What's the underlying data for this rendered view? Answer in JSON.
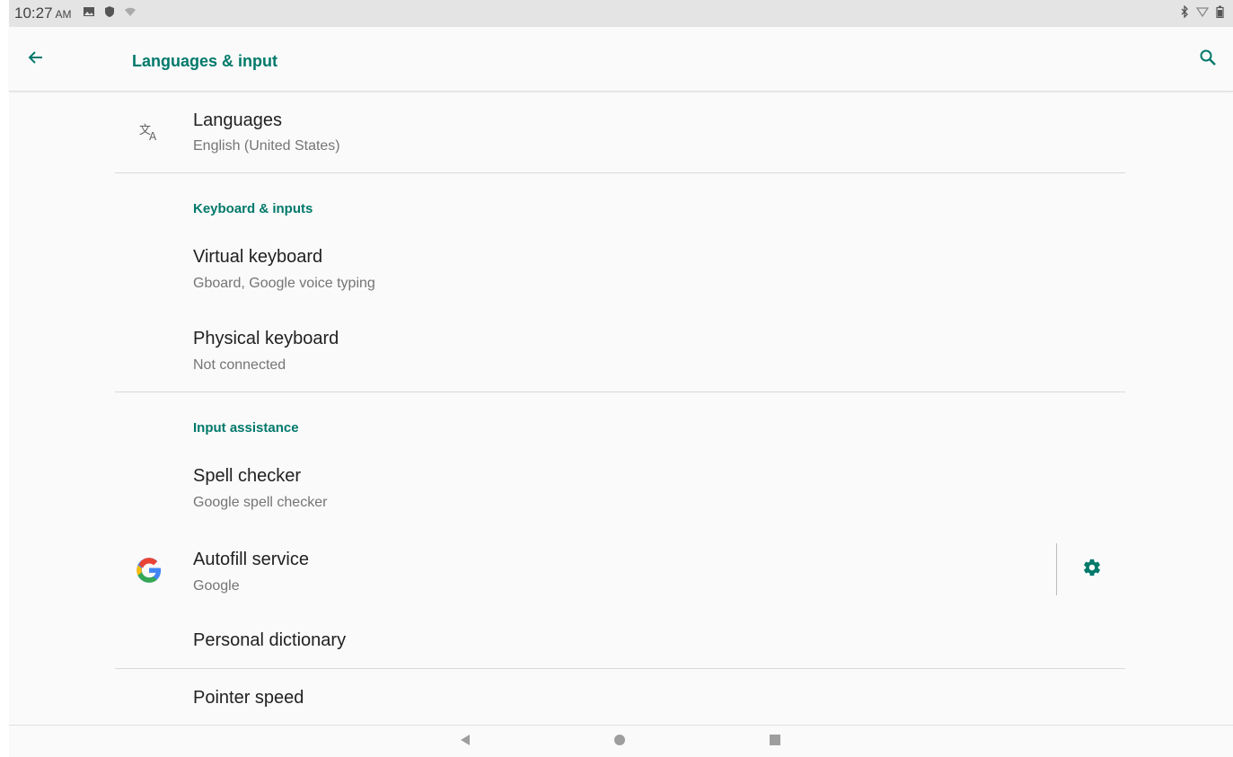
{
  "status_bar": {
    "time": "10:27",
    "ampm": "AM",
    "icons_left": [
      "image-icon",
      "shield-icon",
      "wifi-off-icon"
    ],
    "icons_right": [
      "bluetooth-icon",
      "signal-icon",
      "battery-icon"
    ]
  },
  "app_bar": {
    "title": "Languages & input",
    "back_icon": "arrow-left-icon",
    "search_icon": "search-icon"
  },
  "list": {
    "languages": {
      "title": "Languages",
      "summary": "English (United States)",
      "icon": "translate-icon"
    },
    "section_keyboard": "Keyboard & inputs",
    "virtual_keyboard": {
      "title": "Virtual keyboard",
      "summary": "Gboard, Google voice typing"
    },
    "physical_keyboard": {
      "title": "Physical keyboard",
      "summary": "Not connected"
    },
    "section_assistance": "Input assistance",
    "spell_checker": {
      "title": "Spell checker",
      "summary": "Google spell checker"
    },
    "autofill": {
      "title": "Autofill service",
      "summary": "Google",
      "icon": "google-icon",
      "settings_icon": "gear-icon"
    },
    "personal_dictionary": {
      "title": "Personal dictionary"
    },
    "pointer_speed": {
      "title": "Pointer speed"
    }
  },
  "nav_bar": {
    "buttons": [
      "back-triangle-icon",
      "home-circle-icon",
      "recents-square-icon"
    ]
  },
  "colors": {
    "accent": "#00796b",
    "text_primary": "#212121",
    "text_secondary": "#757575",
    "background": "#fafafa"
  }
}
